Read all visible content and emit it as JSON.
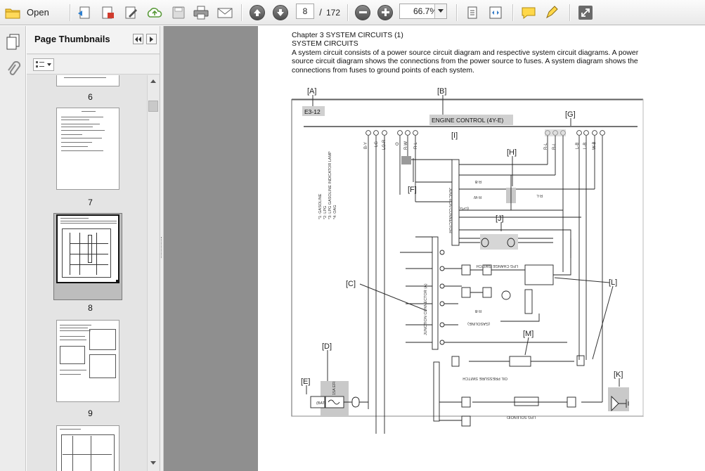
{
  "toolbar": {
    "open_label": "Open",
    "page_current": "8",
    "page_total_sep": "/",
    "page_total": "172",
    "zoom_value": "66.7%"
  },
  "sidebar": {
    "title": "Page Thumbnails",
    "thumbnails": [
      {
        "label": "6"
      },
      {
        "label": "7"
      },
      {
        "label": "8",
        "selected": true
      },
      {
        "label": "9"
      }
    ]
  },
  "document": {
    "heading": "Chapter 3 SYSTEM CIRCUITS (1)",
    "subheading": "SYSTEM CIRCUITS",
    "paragraph_lines": [
      "A system circuit consists of a power source circuit diagram and respective system circuit diagrams. A power",
      "source circuit diagram shows the connections from the power source to fuses. A system diagram shows the",
      "connections from fuses to ground points of each system."
    ],
    "diagram": {
      "callouts": [
        "[A]",
        "[B]",
        "[C]",
        "[D]",
        "[E]",
        "[F]",
        "[G]",
        "[H]",
        "[I]",
        "[J]",
        "[K]",
        "[L]",
        "[M]"
      ],
      "page_ref": "E3-12",
      "system_title": "ENGINE CONTROL (4Y-E)",
      "fuse_label": "(BAT)",
      "fuse_rating": "15A EFI",
      "wire_labels": [
        "B-Y",
        "LG",
        "LG-R",
        "O",
        "R-W",
        "R-L",
        "R-L",
        "R-L",
        "L-B",
        "L-B",
        "W-B",
        "R-B",
        "R-B",
        "R-W",
        "R-L"
      ],
      "connector_labels": [
        "JUNCTION CONNECTOR",
        "JUNCTION CONNECTOR (A)",
        "LPG CHANGE SWITCH",
        "OIL PRESSURE SWITCH",
        "LPG SOLENOID",
        "(GASOLINE)",
        "(LPG)"
      ],
      "legend_lines": [
        "*1: GASOLINE",
        "*2: LPG",
        "*3: LPG GASOLINE INDICATOR LAMP",
        "*4: OAG"
      ]
    }
  },
  "colors": {
    "accent_arrows": "#7a7a7a",
    "toolbar_bg": "#efefef",
    "doc_bg": "#8f8f8f",
    "diagram_box": "#c9c9c9"
  }
}
